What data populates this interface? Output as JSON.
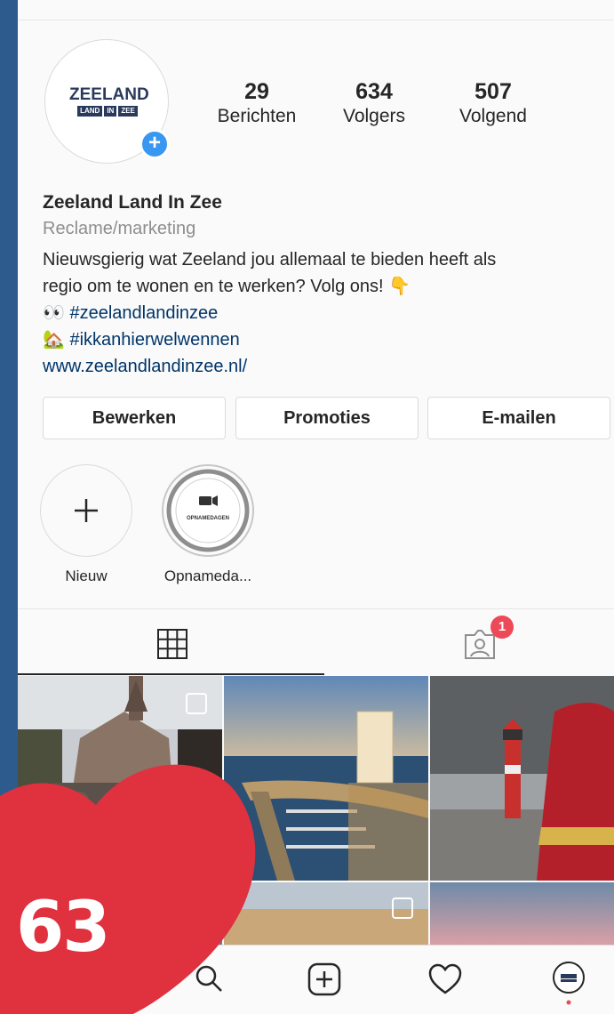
{
  "profile": {
    "logo_main": "ZEELAND",
    "logo_words": [
      "LAND",
      "IN",
      "ZEE"
    ],
    "name": "Zeeland Land In Zee",
    "category": "Reclame/marketing",
    "bio_line1": "Nieuwsgierig wat Zeeland jou allemaal te bieden heeft als",
    "bio_line2": "regio om te wonen en te werken? Volg ons! 👇",
    "tag1_emoji": "👀",
    "tag1": "#zeelandlandinzee",
    "tag2_emoji": "🏡",
    "tag2": "#ikkanhierwelwennen",
    "website": "www.zeelandlandinzee.nl/"
  },
  "stats": [
    {
      "value": "29",
      "label": "Berichten"
    },
    {
      "value": "634",
      "label": "Volgers"
    },
    {
      "value": "507",
      "label": "Volgend"
    }
  ],
  "buttons": {
    "edit": "Bewerken",
    "promotions": "Promoties",
    "email": "E-mailen"
  },
  "highlights": [
    {
      "label": "Nieuw",
      "icon": "plus-icon"
    },
    {
      "label": "Opnameda...",
      "icon": "video-camera-icon",
      "inner_text": "OPNAMEDAGEN"
    }
  ],
  "tabs": {
    "grid_icon": "grid-icon",
    "tagged_icon": "tagged-person-icon",
    "tagged_badge": "1"
  },
  "bottom_nav": [
    "search-icon",
    "add-post-icon",
    "heart-icon",
    "profile-avatar-icon"
  ],
  "overlay": {
    "likes": "63"
  },
  "colors": {
    "background": "#2d5b8e",
    "accent_blue": "#3897f0",
    "heart_red": "#e0313f",
    "badge_red": "#ed4956"
  }
}
